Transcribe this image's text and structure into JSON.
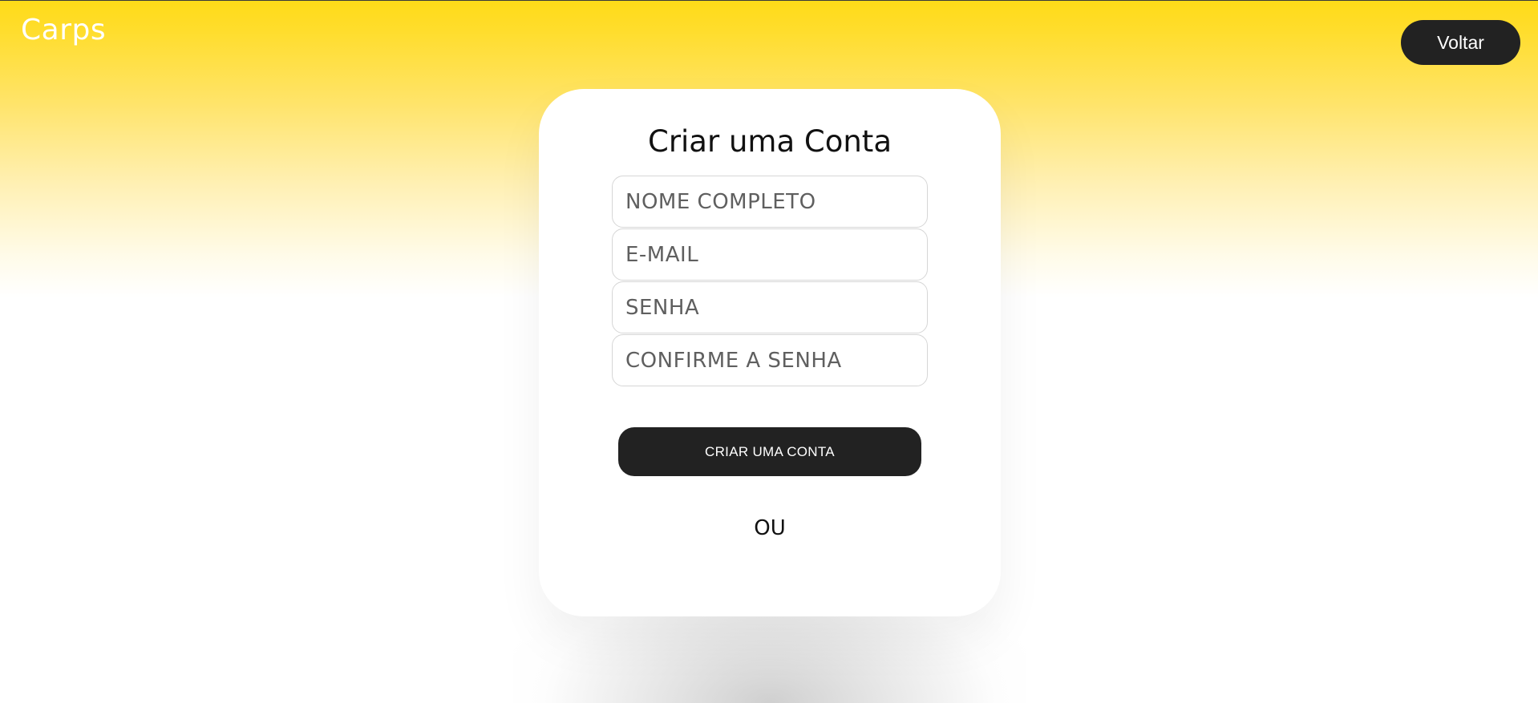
{
  "brand": {
    "name": "Carps"
  },
  "header": {
    "back_label": "Voltar"
  },
  "signup": {
    "title": "Criar uma Conta",
    "fields": {
      "full_name_placeholder": "NOME COMPLETO",
      "email_placeholder": "E-MAIL",
      "password_placeholder": "SENHA",
      "confirm_password_placeholder": "CONFIRME A SENHA"
    },
    "submit_label": "CRIAR UMA CONTA",
    "divider_text": "OU"
  },
  "colors": {
    "accent_yellow": "#ffdb18",
    "button_dark": "#222222",
    "card_background": "#ffffff"
  }
}
